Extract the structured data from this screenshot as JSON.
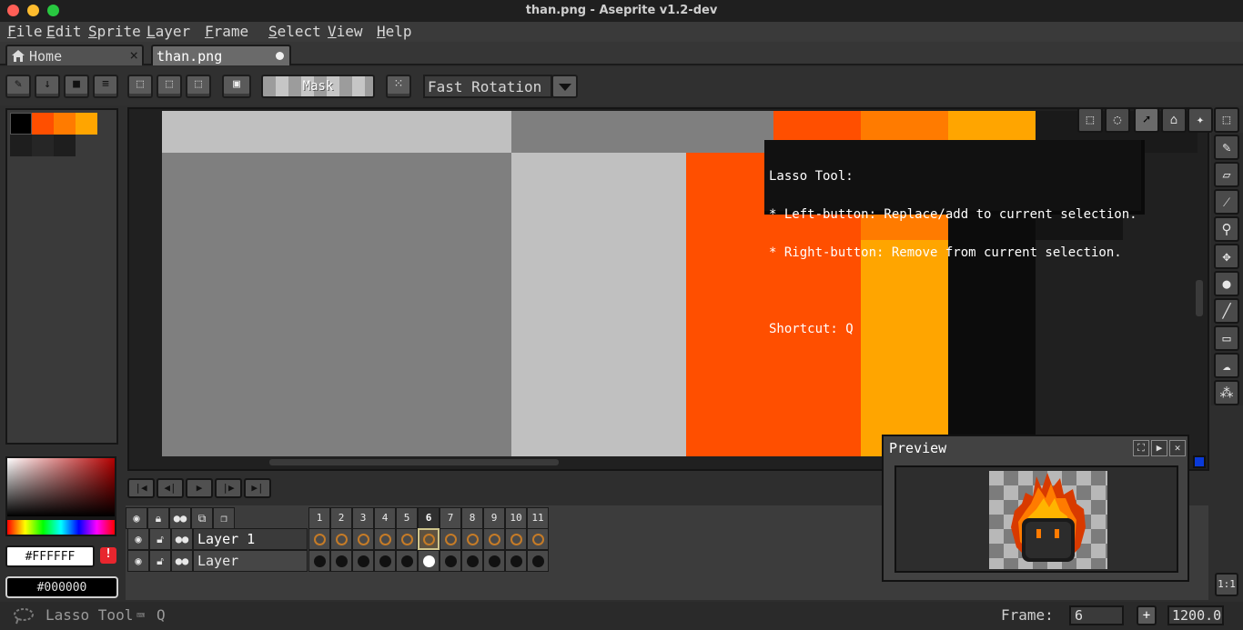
{
  "window": {
    "title": "than.png - Aseprite v1.2-dev"
  },
  "menu": [
    "File",
    "Edit",
    "Sprite",
    "Layer",
    "Frame",
    "Select",
    "View",
    "Help"
  ],
  "tabs": [
    {
      "label": "Home",
      "icon": "home-icon",
      "close": "×"
    },
    {
      "label": "than.png",
      "modified": true
    }
  ],
  "toolbar": {
    "mask_label": "Mask",
    "rotation_algorithm": "Fast Rotation"
  },
  "palette": {
    "colors": [
      "#000000",
      "#ff4f00",
      "#ff7b00",
      "#ffa500"
    ],
    "foreground": "#FFFFFF",
    "background": "#000000",
    "warning_icon": "!"
  },
  "canvas": {
    "colors": {
      "light_gray": "#c0c0c0",
      "mid_gray": "#7f7f7f",
      "red_orange": "#ff4f00",
      "orange": "#ff7b00",
      "amber": "#ffa500",
      "black": "#0c0c0c",
      "dark": "#1a1a1a"
    }
  },
  "tooltip": {
    "title": "Lasso Tool:",
    "line1": "* Left-button: Replace/add to current selection.",
    "line2": "* Right-button: Remove from current selection.",
    "shortcut": "Shortcut: Q"
  },
  "timeline": {
    "frames": [
      "1",
      "2",
      "3",
      "4",
      "5",
      "6",
      "7",
      "8",
      "9",
      "10",
      "11"
    ],
    "active_frame": "6",
    "layers": [
      {
        "name": "Layer 1",
        "selected": true
      },
      {
        "name": "Layer",
        "selected": false
      }
    ]
  },
  "preview": {
    "title": "Preview"
  },
  "zoom_ratio": "1:1",
  "status": {
    "tool": "Lasso Tool",
    "shortcut": "Q",
    "frame_label": "Frame:",
    "frame_value": "6",
    "plus": "+",
    "zoom_value": "1200.0"
  }
}
